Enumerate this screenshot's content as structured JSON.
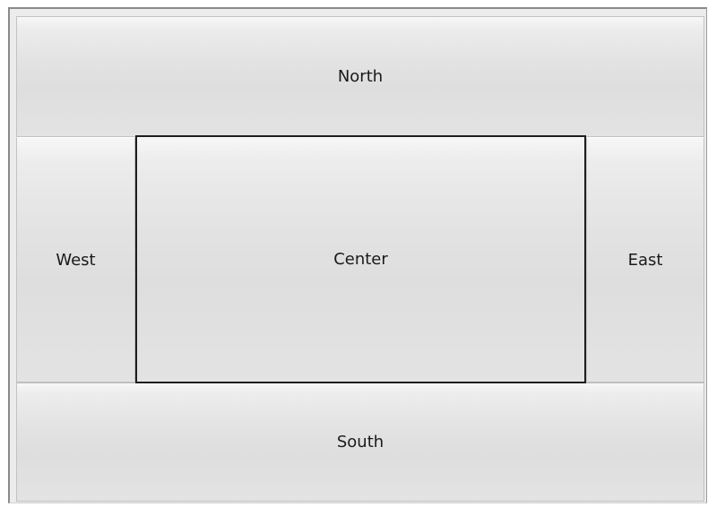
{
  "layout_demo": {
    "north_label": "North",
    "west_label": "West",
    "center_label": "Center",
    "east_label": "East",
    "south_label": "South"
  },
  "colors": {
    "button_face": "#e2e2e2",
    "center_border": "#1e1e1e",
    "text": "#1a1a1a"
  }
}
